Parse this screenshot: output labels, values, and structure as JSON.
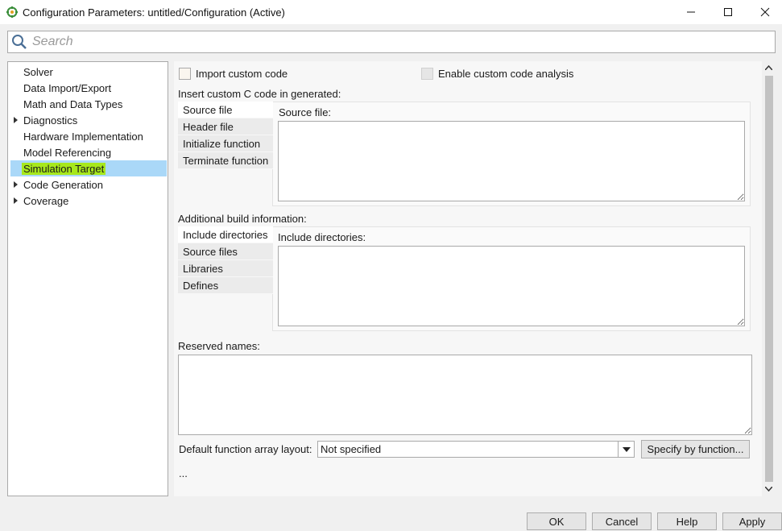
{
  "window": {
    "title": "Configuration Parameters: untitled/Configuration (Active)",
    "icon": "simulink-config-icon",
    "controls": [
      "minimize",
      "maximize",
      "close"
    ]
  },
  "search": {
    "placeholder": "Search",
    "value": ""
  },
  "tree": {
    "items": [
      {
        "label": "Solver",
        "expandable": false,
        "selected": false
      },
      {
        "label": "Data Import/Export",
        "expandable": false,
        "selected": false
      },
      {
        "label": "Math and Data Types",
        "expandable": false,
        "selected": false
      },
      {
        "label": "Diagnostics",
        "expandable": true,
        "selected": false
      },
      {
        "label": "Hardware Implementation",
        "expandable": false,
        "selected": false
      },
      {
        "label": "Model Referencing",
        "expandable": false,
        "selected": false
      },
      {
        "label": "Simulation Target",
        "expandable": false,
        "selected": true
      },
      {
        "label": "Code Generation",
        "expandable": true,
        "selected": false
      },
      {
        "label": "Coverage",
        "expandable": true,
        "selected": false
      }
    ],
    "selected_highlight_color": "#aad8f8",
    "marker_highlight_color": "#a7e81c"
  },
  "panel": {
    "import_custom_code": {
      "label": "Import custom code",
      "checked": false
    },
    "enable_custom_code_analysis": {
      "label": "Enable custom code analysis",
      "checked": false,
      "enabled": false
    },
    "insert_custom_code_heading": "Insert custom C code in generated:",
    "custom_code_tabs": [
      "Source file",
      "Header file",
      "Initialize function",
      "Terminate function"
    ],
    "custom_code_field_label": "Source file:",
    "build_info_heading": "Additional build information:",
    "build_tabs": [
      "Include directories",
      "Source files",
      "Libraries",
      "Defines"
    ],
    "build_field_label": "Include directories:",
    "reserved_names_label": "Reserved names:",
    "array_layout_label": "Default function array layout:",
    "array_layout_value": "Not specified",
    "specify_button": "Specify by function...",
    "ellipsis": "..."
  },
  "footer": {
    "ok": "OK",
    "cancel": "Cancel",
    "help": "Help",
    "apply": "Apply"
  }
}
